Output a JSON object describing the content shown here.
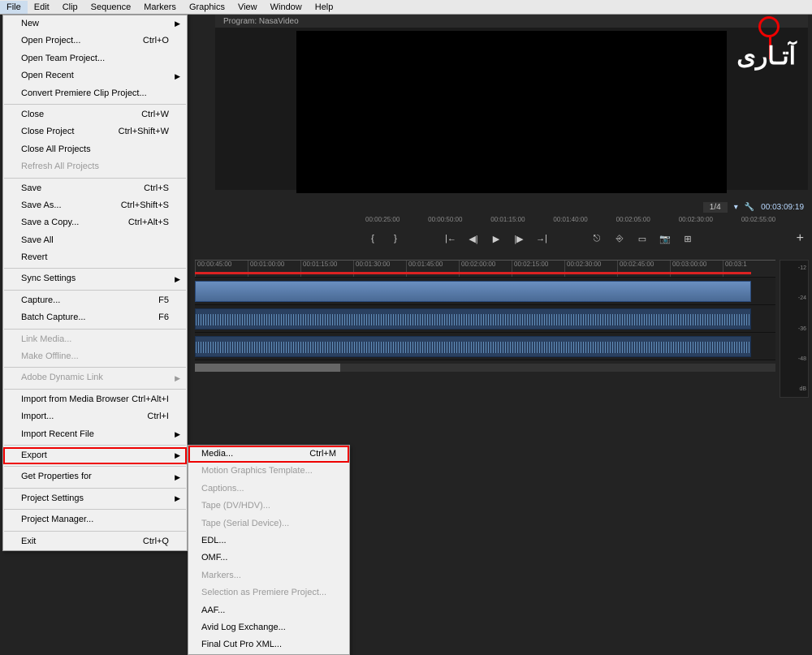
{
  "menubar": [
    "File",
    "Edit",
    "Clip",
    "Sequence",
    "Markers",
    "Graphics",
    "View",
    "Window",
    "Help"
  ],
  "fileMenu": {
    "groups": [
      [
        {
          "label": "New",
          "sub": true
        },
        {
          "label": "Open Project...",
          "short": "Ctrl+O"
        },
        {
          "label": "Open Team Project..."
        },
        {
          "label": "Open Recent",
          "sub": true
        },
        {
          "label": "Convert Premiere Clip Project..."
        }
      ],
      [
        {
          "label": "Close",
          "short": "Ctrl+W"
        },
        {
          "label": "Close Project",
          "short": "Ctrl+Shift+W"
        },
        {
          "label": "Close All Projects"
        },
        {
          "label": "Refresh All Projects",
          "dis": true
        }
      ],
      [
        {
          "label": "Save",
          "short": "Ctrl+S"
        },
        {
          "label": "Save As...",
          "short": "Ctrl+Shift+S"
        },
        {
          "label": "Save a Copy...",
          "short": "Ctrl+Alt+S"
        },
        {
          "label": "Save All"
        },
        {
          "label": "Revert"
        }
      ],
      [
        {
          "label": "Sync Settings",
          "sub": true
        }
      ],
      [
        {
          "label": "Capture...",
          "short": "F5"
        },
        {
          "label": "Batch Capture...",
          "short": "F6"
        }
      ],
      [
        {
          "label": "Link Media...",
          "dis": true
        },
        {
          "label": "Make Offline...",
          "dis": true
        }
      ],
      [
        {
          "label": "Adobe Dynamic Link",
          "sub": true,
          "dis": true
        }
      ],
      [
        {
          "label": "Import from Media Browser",
          "short": "Ctrl+Alt+I"
        },
        {
          "label": "Import...",
          "short": "Ctrl+I"
        },
        {
          "label": "Import Recent File",
          "sub": true
        }
      ],
      [
        {
          "label": "Export",
          "sub": true,
          "hl": true
        }
      ],
      [
        {
          "label": "Get Properties for",
          "sub": true
        }
      ],
      [
        {
          "label": "Project Settings",
          "sub": true
        }
      ],
      [
        {
          "label": "Project Manager..."
        }
      ],
      [
        {
          "label": "Exit",
          "short": "Ctrl+Q"
        }
      ]
    ]
  },
  "exportMenu": [
    {
      "label": "Media...",
      "short": "Ctrl+M",
      "hl": true
    },
    {
      "label": "Motion Graphics Template...",
      "dis": true
    },
    {
      "label": "Captions...",
      "dis": true
    },
    {
      "label": "Tape (DV/HDV)...",
      "dis": true
    },
    {
      "label": "Tape (Serial Device)...",
      "dis": true
    },
    {
      "label": "EDL..."
    },
    {
      "label": "OMF..."
    },
    {
      "label": "Markers...",
      "dis": true
    },
    {
      "label": "Selection as Premiere Project...",
      "dis": true
    },
    {
      "label": "AAF..."
    },
    {
      "label": "Avid Log Exchange..."
    },
    {
      "label": "Final Cut Pro XML..."
    }
  ],
  "program": {
    "title": "Program: NasaVideo"
  },
  "status": {
    "zoom": "1/4",
    "tc": "00:03:09:19"
  },
  "tcbar": [
    "00:00:25:00",
    "00:00:50:00",
    "00:01:15:00",
    "00:01:40:00",
    "00:02:05:00",
    "00:02:30:00",
    "00:02:55:00"
  ],
  "ruler": [
    "00:00:45:00",
    "00:01:00:00",
    "00:01:15:00",
    "00:01:30:00",
    "00:01:45:00",
    "00:02:00:00",
    "00:02:15:00",
    "00:02:30:00",
    "00:02:45:00",
    "00:03:00:00",
    "00:03:1"
  ],
  "meter": [
    "-12",
    "-24",
    "-36",
    "-48",
    "dB"
  ],
  "logo": "آتـاری",
  "icons": {
    "markIn": "{",
    "markOut": "}",
    "goIn": "|←",
    "stepB": "◀|",
    "play": "▶",
    "stepF": "|▶",
    "goOut": "→|",
    "lift": "⎋",
    "extract": "⎆",
    "frame": "▭",
    "cam": "📷",
    "safe": "⊞",
    "plus": "+",
    "chev": "▾",
    "wrench": "🔧"
  }
}
